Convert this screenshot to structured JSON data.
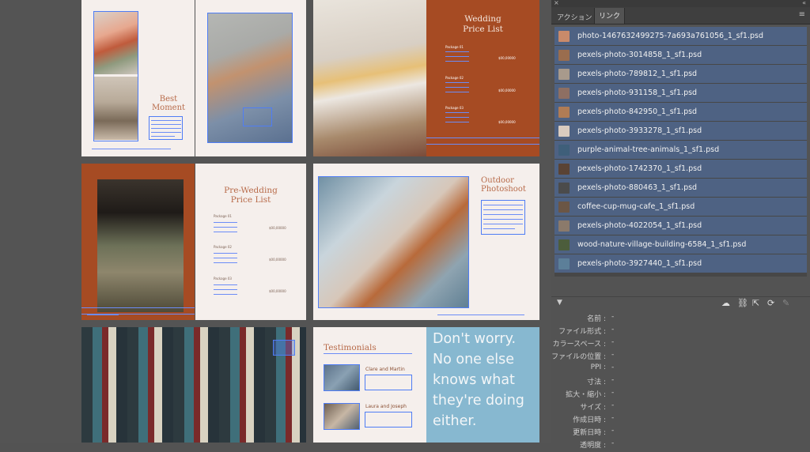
{
  "panel": {
    "tabs": [
      {
        "label": "アクション"
      },
      {
        "label": "リンク"
      }
    ],
    "links": [
      {
        "name": "photo-1467632499275-7a693a761056_1_sf1.psd",
        "thumb_color": "#c98a6a"
      },
      {
        "name": "pexels-photo-3014858_1_sf1.psd",
        "thumb_color": "#9a6d4e"
      },
      {
        "name": "pexels-photo-789812_1_sf1.psd",
        "thumb_color": "#a89a8c"
      },
      {
        "name": "pexels-photo-931158_1_sf1.psd",
        "thumb_color": "#8e6f63"
      },
      {
        "name": "pexels-photo-842950_1_sf1.psd",
        "thumb_color": "#b07c55"
      },
      {
        "name": "pexels-photo-3933278_1_sf1.psd",
        "thumb_color": "#d9cbbf"
      },
      {
        "name": "purple-animal-tree-animals_1_sf1.psd",
        "thumb_color": "#3f5f7a"
      },
      {
        "name": "pexels-photo-1742370_1_sf1.psd",
        "thumb_color": "#5a4334"
      },
      {
        "name": "pexels-photo-880463_1_sf1.psd",
        "thumb_color": "#4b4b4b"
      },
      {
        "name": "coffee-cup-mug-cafe_1_sf1.psd",
        "thumb_color": "#6b5645"
      },
      {
        "name": "pexels-photo-4022054_1_sf1.psd",
        "thumb_color": "#8b7a6b"
      },
      {
        "name": "wood-nature-village-building-6584_1_sf1.psd",
        "thumb_color": "#4c5d3c"
      },
      {
        "name": "pexels-photo-3927440_1_sf1.psd",
        "thumb_color": "#5c7f99"
      }
    ],
    "info": [
      {
        "key": "名前 :",
        "value": "-"
      },
      {
        "key": "ファイル形式 :",
        "value": "-"
      },
      {
        "key": "カラースペース :",
        "value": "-"
      },
      {
        "key": "ファイルの位置 :",
        "value": "-"
      },
      {
        "key": "PPI :",
        "value": "-"
      },
      {
        "key": "寸法 :",
        "value": "-"
      },
      {
        "key": "拡大・縮小 :",
        "value": "-"
      },
      {
        "key": "サイズ :",
        "value": "-"
      },
      {
        "key": "作成日時 :",
        "value": "-"
      },
      {
        "key": "更新日時 :",
        "value": "-"
      },
      {
        "key": "透明度 :",
        "value": "-"
      }
    ]
  },
  "document": {
    "best_moment": [
      "Best",
      "Moment"
    ],
    "wedding_price": [
      "Wedding",
      "Price List"
    ],
    "pre_wedding_price": [
      "Pre-Wedding",
      "Price List"
    ],
    "outdoor": [
      "Outdoor",
      "Photoshoot"
    ],
    "testimonials": "Testimonials",
    "clare_and_martin": "Clare and Martin",
    "laura_and_joseph": "Laura and Joseph",
    "quote": [
      "Don't worry.",
      "No one else",
      "knows what",
      "they're doing",
      "either."
    ],
    "package_1": "Package 01",
    "package_2": "Package 02",
    "package_3": "Package 03",
    "price": "$00,00000"
  }
}
